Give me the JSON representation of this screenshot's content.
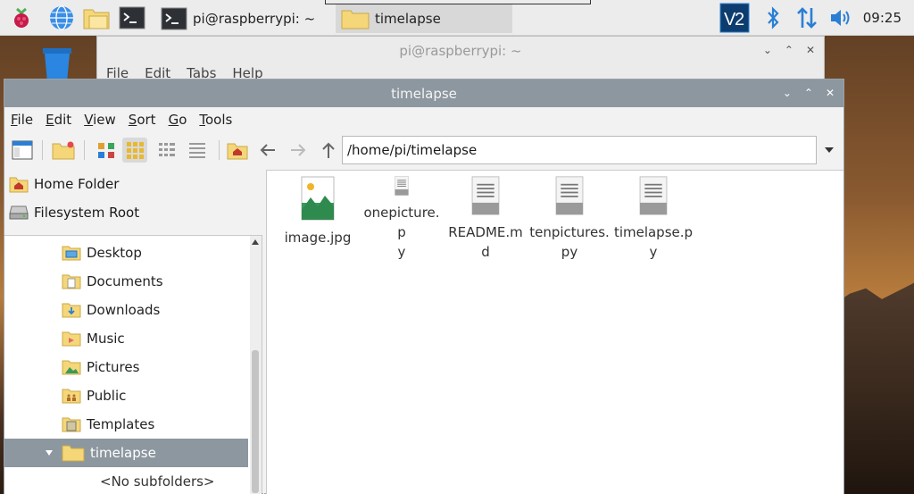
{
  "panel": {
    "tasks": [
      {
        "label": "pi@raspberrypi: ~",
        "icon": "terminal-icon"
      },
      {
        "label": "timelapse",
        "icon": "folder-icon"
      }
    ],
    "clock": "09:25",
    "tray_icons": [
      "vnc-icon",
      "bluetooth-icon",
      "network-icon",
      "volume-icon"
    ]
  },
  "terminal_window": {
    "title": "pi@raspberrypi: ~",
    "menu": [
      "File",
      "Edit",
      "Tabs",
      "Help"
    ]
  },
  "file_manager": {
    "title": "timelapse",
    "menu": [
      {
        "mnemonic": "F",
        "rest": "ile"
      },
      {
        "mnemonic": "E",
        "rest": "dit"
      },
      {
        "mnemonic": "V",
        "rest": "iew"
      },
      {
        "mnemonic": "S",
        "rest": "ort"
      },
      {
        "mnemonic": "G",
        "rest": "o"
      },
      {
        "mnemonic": "T",
        "rest": "ools"
      }
    ],
    "path": "/home/pi/timelapse",
    "places": [
      "Home Folder",
      "Filesystem Root"
    ],
    "tree": [
      "Desktop",
      "Documents",
      "Downloads",
      "Music",
      "Pictures",
      "Public",
      "Templates",
      "timelapse"
    ],
    "tree_empty": "<No subfolders>",
    "files": [
      {
        "line1": "image.jpg",
        "line2": "",
        "type": "image"
      },
      {
        "line1": "onepicture.p",
        "line2": "y",
        "type": "text"
      },
      {
        "line1": "README.m",
        "line2": "d",
        "type": "text"
      },
      {
        "line1": "tenpictures.",
        "line2": "py",
        "type": "text"
      },
      {
        "line1": "timelapse.p",
        "line2": "y",
        "type": "text"
      }
    ]
  },
  "colors": {
    "titlebar_active": "#8d979f",
    "selection": "#8d979f",
    "folder": "#f5d77a",
    "accent_blue": "#2a7fd4"
  }
}
